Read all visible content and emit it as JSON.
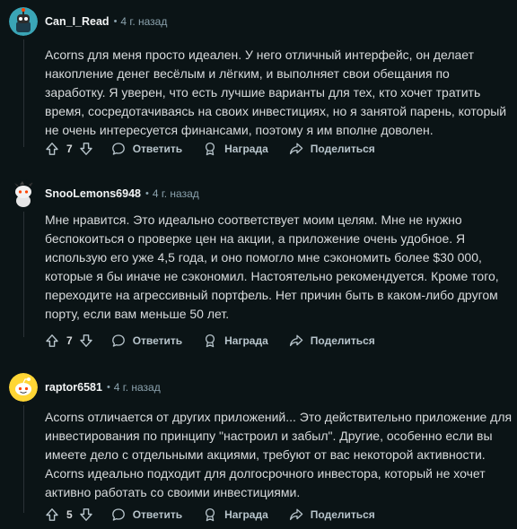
{
  "comments": [
    {
      "author": "Can_I_Read",
      "time": "4 г. назад",
      "lines": [
        "Acorns для меня просто идеален. У него отличный интерфейс, он делает",
        "накопление денег весёлым и лёгким, и выполняет свои обещания по",
        "заработку. Я уверен, что есть лучшие варианты для тех, кто хочет тратить",
        "время, сосредотачиваясь на своих инвестициях, но я занятой парень, который",
        "не очень интересуется финансами, поэтому я им вполне доволен."
      ],
      "score": "7",
      "reply_label": "Ответить",
      "award_label": "Награда",
      "share_label": "Поделиться"
    },
    {
      "author": "SnooLemons6948",
      "time": "4 г. назад",
      "lines": [
        "Мне нравится. Это идеально соответствует моим целям. Мне не нужно",
        "беспокоиться о проверке цен на акции, а приложение очень удобное. Я",
        "использую его уже 4,5 года, и оно помогло мне сэкономить более $30 000,",
        "которые я бы иначе не сэкономил. Настоятельно рекомендуется. Кроме того,",
        "переходите на агрессивный портфель. Нет причин быть в каком-либо другом",
        "порту, если вам меньше 50 лет."
      ],
      "score": "7",
      "reply_label": "Ответить",
      "award_label": "Награда",
      "share_label": "Поделиться"
    },
    {
      "author": "raptor6581",
      "time": "4 г. назад",
      "lines": [
        "Acorns отличается от других приложений... Это действительно приложение для",
        "инвестирования по принципу \"настроил и забыл\". Другие, особенно если вы",
        "имеете дело с отдельными акциями, требуют от вас некоторой активности.",
        "Acorns идеально подходит для долгосрочного инвестора, который не хочет",
        "активно работать со своими инвестициями."
      ],
      "score": "5",
      "reply_label": "Ответить",
      "award_label": "Награда",
      "share_label": "Поделиться"
    }
  ],
  "separator": "•",
  "colors": {
    "background": "#0b1416",
    "text": "#d7dadc",
    "meta": "#8ba2ad",
    "author": "#f2f4f5"
  },
  "icons": {
    "upvote": "arrow-up-icon",
    "downvote": "arrow-down-icon",
    "reply": "speech-bubble-icon",
    "award": "award-icon",
    "share": "share-icon"
  }
}
